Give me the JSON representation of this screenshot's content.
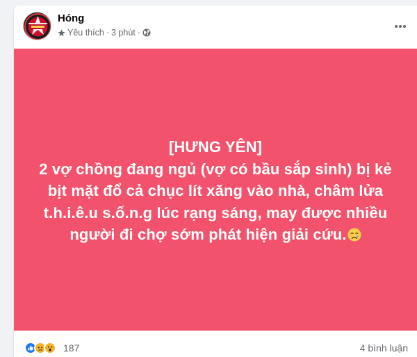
{
  "post": {
    "author": "Hóng",
    "favorite_label": "Yêu thích",
    "separator": "·",
    "time": "3 phút",
    "separator2": "·",
    "privacy_icon": "globe-icon",
    "more_icon": "more-options-icon"
  },
  "banner": {
    "background_color": "#f2526c",
    "text_color": "#ffffff",
    "lines": [
      "[HƯNG YÊN]",
      "2 vợ chồng đang ngủ (vợ có bầu sắp sinh) bị kẻ",
      "bịt mặt đổ cả chục lít xăng vào nhà, châm lửa",
      "t.h.i.ê.u s.ố.n.g lúc rạng sáng, may được nhiều",
      "người đi chợ sớm phát hiện giải cứu."
    ],
    "trailing_emoji": "crying-face-emoji"
  },
  "footer": {
    "reaction_icons": [
      "like-reaction-icon",
      "sad-reaction-icon",
      "wow-reaction-icon"
    ],
    "reaction_count": "187",
    "comment_count": "4 bình luận"
  }
}
